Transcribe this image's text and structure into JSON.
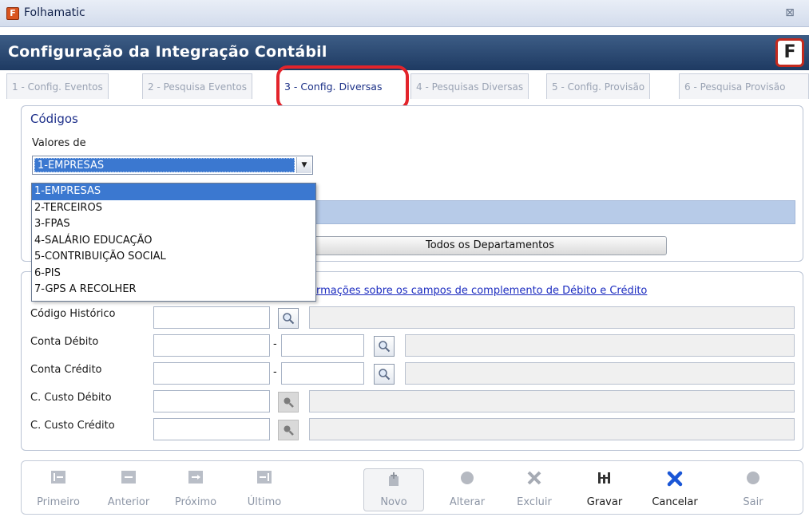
{
  "window": {
    "title": "Folhamatic",
    "close_glyph": "⊠",
    "icon_letter": "F"
  },
  "header": {
    "title": "Configuração da Integração Contábil",
    "logo_letter": "F"
  },
  "tabs": [
    {
      "label": "1 - Config. Eventos",
      "active": false
    },
    {
      "label": "2 - Pesquisa Eventos",
      "active": false
    },
    {
      "label": "3 - Config. Diversas",
      "active": true
    },
    {
      "label": "4 - Pesquisas Diversas",
      "active": false
    },
    {
      "label": "5 - Config. Provisão",
      "active": false
    },
    {
      "label": "6 - Pesquisa Provisão",
      "active": false
    }
  ],
  "codigos": {
    "title": "Códigos",
    "valores_label": "Valores de",
    "selected_value": "1-EMPRESAS",
    "options": [
      "1-EMPRESAS",
      "2-TERCEIROS",
      "3-FPAS",
      "4-SALÁRIO EDUCAÇÃO",
      "5-CONTRIBUIÇÃO SOCIAL",
      "6-PIS",
      "7-GPS A RECOLHER"
    ],
    "dept_button": "Todos os Departamentos"
  },
  "complemento": {
    "info_link": "rmações sobre os campos de complemento de Débito e Crédito",
    "fields": {
      "codigo_historico": "Código Histórico",
      "conta_debito": "Conta Débito",
      "conta_credito": "Conta Crédito",
      "c_custo_debito": "C. Custo Débito",
      "c_custo_credito": "C. Custo Crédito"
    },
    "dash": "-"
  },
  "toolbar": {
    "primeiro": "Primeiro",
    "anterior": "Anterior",
    "proximo": "Próximo",
    "ultimo": "Último",
    "novo": "Novo",
    "alterar": "Alterar",
    "excluir": "Excluir",
    "gravar": "Gravar",
    "cancelar": "Cancelar",
    "sair": "Sair"
  },
  "colors": {
    "header_bg": "#1e3a62",
    "selection": "#3b78d0",
    "highlight_ring": "#e3242b",
    "link": "#1c2cc0"
  }
}
